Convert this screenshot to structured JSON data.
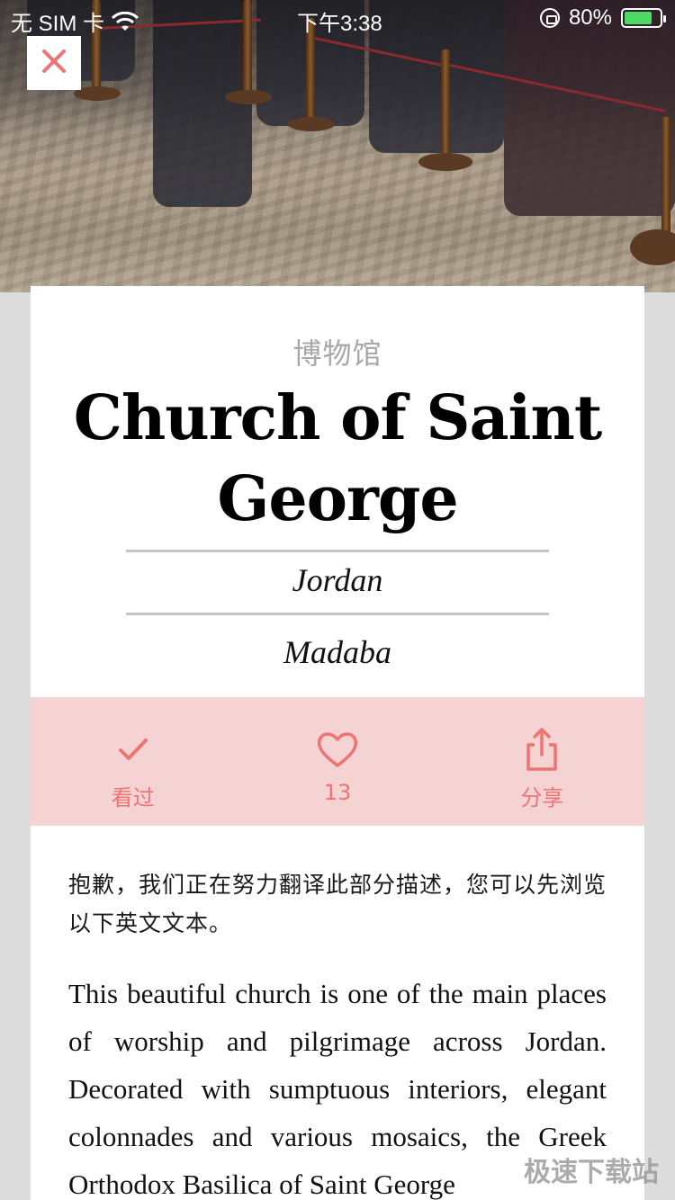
{
  "status_bar": {
    "carrier": "无 SIM 卡",
    "time": "下午3:38",
    "battery": "80%",
    "battery_level": 0.8,
    "icons": [
      "wifi-icon",
      "orientation-lock-icon",
      "battery-icon"
    ]
  },
  "header": {
    "close_icon": "close-icon",
    "accent_color": "#ee7474"
  },
  "place": {
    "category": "博物馆",
    "title": "Church of Saint George",
    "country": "Jordan",
    "city": "Madaba"
  },
  "actions": [
    {
      "icon": "checkmark-icon",
      "label": "看过"
    },
    {
      "icon": "heart-icon",
      "label": "13"
    },
    {
      "icon": "share-icon",
      "label": "分享"
    }
  ],
  "content": {
    "notice": "抱歉，我们正在努力翻译此部分描述，您可以先浏览以下英文文本。",
    "description": "This beautiful church is one of the main places of worship and pilgrimage across Jordan. Decorated with sumptuous interiors, elegant colonnades and various mosaics, the Greek Orthodox Basilica of Saint George"
  },
  "watermark": "极速下载站",
  "colors": {
    "action_bar_bg": "#f5d3d3",
    "action_color": "#ee7474",
    "page_bg": "#dcdcdc"
  }
}
